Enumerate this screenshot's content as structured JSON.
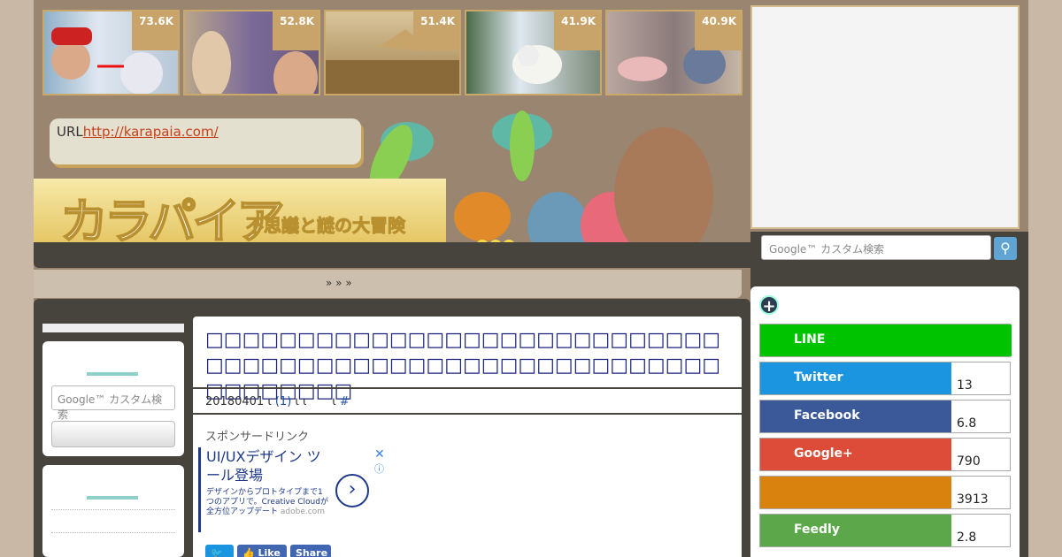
{
  "thumbnails": [
    {
      "count": "73.6K"
    },
    {
      "count": "52.8K"
    },
    {
      "count": "51.4K"
    },
    {
      "count": "41.9K"
    },
    {
      "count": "40.9K"
    }
  ],
  "url_box": {
    "label": "URL",
    "link": "http://karapaia.com/"
  },
  "logo": {
    "title": "カラパイア",
    "subtitle": "不思議と謎の大冒険"
  },
  "breadcrumb": "» » »",
  "search": {
    "placeholder": "Google™ カスタム検索"
  },
  "article": {
    "title": "□□□□□□□□□□□□□□□□□□□□□□□□□□□□□□□□□□□□□□□□□□□□□□□□□□□□□□□□□□□□□□□□",
    "date": "20180401",
    "meta_mark1": "ι",
    "comments": "(1)",
    "meta_mark2": "ι ι",
    "meta_mark3": "ι",
    "hash": "#",
    "sponsor_label": "スポンサードリンク"
  },
  "ad": {
    "headline": "UI/UXデザイン ツール登場",
    "description": "デザインからプロトタイプまで1つのアプリで。Creative Cloudが全方位アップデート",
    "domain": "adobe.com",
    "close": "✕",
    "info": "ⓘ"
  },
  "article_share": {
    "twitter": "🐦",
    "like": "Like",
    "share": "Share"
  },
  "share_buttons": [
    {
      "label": "LINE",
      "count": "",
      "color": "#00c300"
    },
    {
      "label": "Twitter",
      "count": "13",
      "color": "#1b95e0"
    },
    {
      "label": "Facebook",
      "count": "6.8",
      "color": "#3b5998"
    },
    {
      "label": "Google+",
      "count": "790",
      "color": "#dd4b39"
    },
    {
      "label": "",
      "count": "3913",
      "color": "#d9820d"
    },
    {
      "label": "Feedly",
      "count": "2.8",
      "color": "#5ca749"
    }
  ],
  "colors": {
    "accent_teal": "#8fd0c8",
    "frame_dark": "#47433d",
    "page_bg": "#9a8570"
  }
}
